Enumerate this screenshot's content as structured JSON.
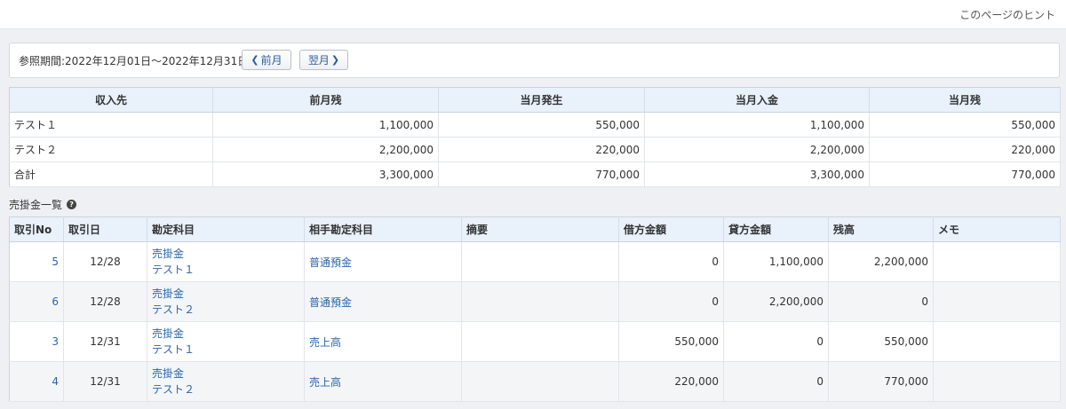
{
  "header": {
    "hint_link": "このページのヒント"
  },
  "period": {
    "label": "参照期間:2022年12月01日～2022年12月31日",
    "prev_label": "前月",
    "next_label": "翌月"
  },
  "summary": {
    "columns": [
      "収入先",
      "前月残",
      "当月発生",
      "当月入金",
      "当月残"
    ],
    "rows": [
      [
        "テスト１",
        "1,100,000",
        "550,000",
        "1,100,000",
        "550,000"
      ],
      [
        "テスト２",
        "2,200,000",
        "220,000",
        "2,200,000",
        "220,000"
      ],
      [
        "合計",
        "3,300,000",
        "770,000",
        "3,300,000",
        "770,000"
      ]
    ]
  },
  "ledger": {
    "title": "売掛金一覧",
    "help_icon": "question-circle-icon",
    "columns": [
      "取引No",
      "取引日",
      "勘定科目",
      "相手勘定科目",
      "摘要",
      "借方金額",
      "貸方金額",
      "残高",
      "メモ"
    ],
    "rows": [
      {
        "no": "5",
        "date": "12/28",
        "account": "売掛金",
        "sub": "テスト１",
        "counter": "普通預金",
        "desc": "",
        "debit": "0",
        "credit": "1,100,000",
        "balance": "2,200,000",
        "memo": ""
      },
      {
        "no": "6",
        "date": "12/28",
        "account": "売掛金",
        "sub": "テスト２",
        "counter": "普通預金",
        "desc": "",
        "debit": "0",
        "credit": "2,200,000",
        "balance": "0",
        "memo": ""
      },
      {
        "no": "3",
        "date": "12/31",
        "account": "売掛金",
        "sub": "テスト１",
        "counter": "売上高",
        "desc": "",
        "debit": "550,000",
        "credit": "0",
        "balance": "550,000",
        "memo": ""
      },
      {
        "no": "4",
        "date": "12/31",
        "account": "売掛金",
        "sub": "テスト２",
        "counter": "売上高",
        "desc": "",
        "debit": "220,000",
        "credit": "0",
        "balance": "770,000",
        "memo": ""
      }
    ]
  },
  "colors": {
    "link": "#2a65a8",
    "header_bg": "#e9f1fb",
    "page_bg": "#eff0f3"
  }
}
